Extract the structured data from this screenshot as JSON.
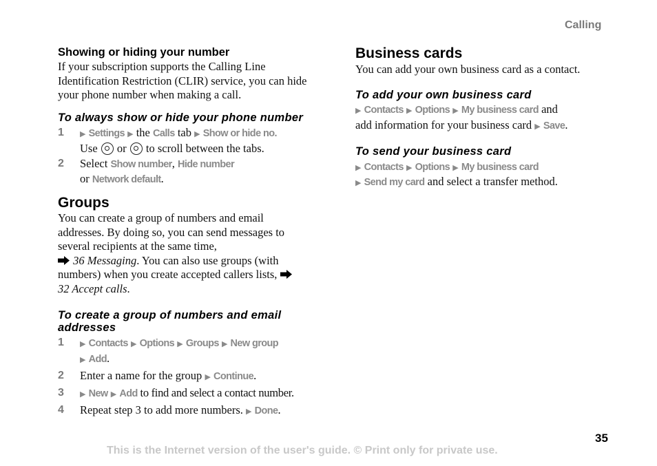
{
  "header": {
    "section_title": "Calling"
  },
  "left": {
    "showing_heading": "Showing or hiding your number",
    "showing_body": "If your subscription supports the Calling Line Identification Restriction (CLIR) service, you can hide your phone number when making a call.",
    "always_heading": "To always show or hide your phone number",
    "always_steps": {
      "s1_num": "1",
      "s1_settings": "Settings",
      "s1_the": " the ",
      "s1_calls": "Calls",
      "s1_tab": " tab ",
      "s1_show": "Show or hide no.",
      "s1_use": "Use ",
      "s1_or": " or ",
      "s1_scroll": " to scroll between the tabs.",
      "s2_num": "2",
      "s2_select": "Select ",
      "s2_show": "Show number",
      "s2_comma": ", ",
      "s2_hide": "Hide number",
      "s2_or": "or ",
      "s2_network": "Network default",
      "s2_period": "."
    },
    "groups_heading": "Groups",
    "groups_body_1": "You can create a group of numbers and email addresses. By doing so, you can send messages to several recipients at the same time,",
    "groups_ref_1": " 36 Messaging",
    "groups_body_2": ". You can also use groups (with numbers) when you create accepted callers lists, ",
    "groups_ref_2": " 32 Accept calls",
    "groups_body_3": ".",
    "create_heading": "To create a group of numbers and email addresses",
    "create_steps": {
      "s1_num": "1",
      "s1_contacts": "Contacts",
      "s1_options": "Options",
      "s1_groups": "Groups",
      "s1_newgroup": "New group",
      "s1_add": "Add",
      "s1_period": ".",
      "s2_num": "2",
      "s2_text": "Enter a name for the group ",
      "s2_continue": "Continue",
      "s2_period": ".",
      "s3_num": "3",
      "s3_new": "New",
      "s3_add": "Add",
      "s3_text": " to find and select a contact number.",
      "s4_num": "4",
      "s4_text": "Repeat step 3 to add more numbers. ",
      "s4_done": "Done",
      "s4_period": "."
    }
  },
  "right": {
    "bc_heading": "Business cards",
    "bc_body": "You can add your own business card as a contact.",
    "add_heading": "To add your own business card",
    "add": {
      "contacts": "Contacts",
      "options": "Options",
      "mycard": "My business card",
      "and": " and",
      "line2": "add information for your business card ",
      "save": "Save",
      "period": "."
    },
    "send_heading": "To send your business card",
    "send": {
      "contacts": "Contacts",
      "options": "Options",
      "mycard": "My business card",
      "sendmy": "Send my card",
      "rest": " and select a transfer method."
    }
  },
  "footer": {
    "page_number": "35",
    "notice": "This is the Internet version of the user's guide. © Print only for private use."
  },
  "icons": {
    "menu_arrow": "▶",
    "reference_arrow": "➡"
  },
  "colors": {
    "menu_gray": "#8a8a8a",
    "footer_gray": "#c8c8c8",
    "header_gray": "#7a7a7a"
  }
}
